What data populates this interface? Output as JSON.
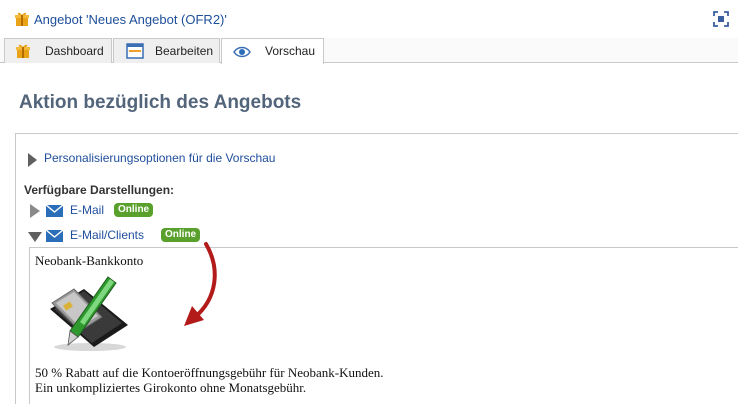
{
  "window": {
    "title": "Angebot 'Neues Angebot (OFR2)'",
    "icons": {
      "app": "gift-icon",
      "maximize": "maximize-icon"
    }
  },
  "tabs": [
    {
      "label": "Dashboard",
      "icon": "gift-icon",
      "active": false
    },
    {
      "label": "Bearbeiten",
      "icon": "form-icon",
      "active": false
    },
    {
      "label": "Vorschau",
      "icon": "eye-icon",
      "active": true
    }
  ],
  "main": {
    "heading": "Aktion bezüglich des Angebots",
    "personalization_link": "Personalisierungsoptionen für die Vorschau",
    "available_label": "Verfügbare Darstellungen:",
    "renditions": [
      {
        "label": "E-Mail",
        "badge": "Online",
        "expanded": false,
        "icon": "mail-icon"
      },
      {
        "label": "E-Mail/Clients",
        "badge": "Online",
        "expanded": true,
        "icon": "mail-icon"
      }
    ],
    "preview": {
      "title": "Neobank-Bankkonto",
      "image": "wallet-card-pen-image",
      "line1": "50 % Rabatt auf die Kontoeröffnungsgebühr für Neobank-Kunden.",
      "line2": "Ein unkompliziertes Girokonto ohne Monatsgebühr."
    }
  },
  "colors": {
    "link": "#1f4e9c",
    "heading": "#53657a",
    "badge": "#5aa02c",
    "annotation_arrow": "#b31b1b",
    "gift": "#e8a317"
  }
}
